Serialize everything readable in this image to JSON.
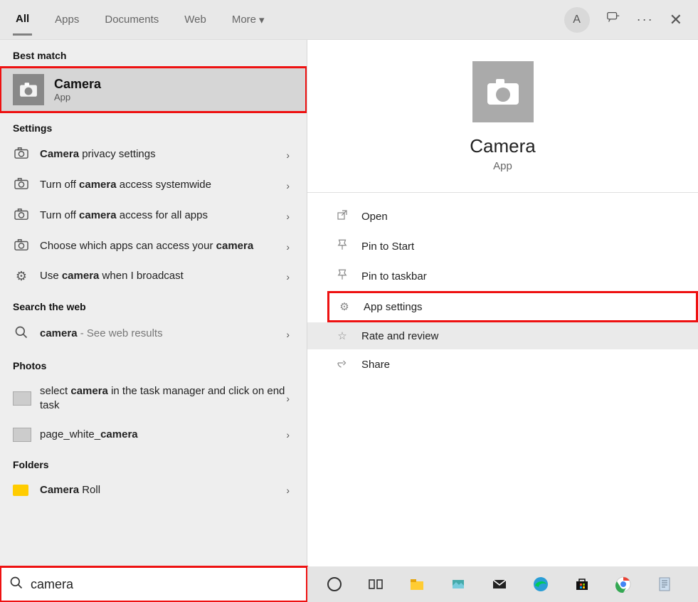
{
  "topbar": {
    "tabs": [
      "All",
      "Apps",
      "Documents",
      "Web",
      "More"
    ],
    "avatar_letter": "A"
  },
  "left": {
    "best_match_label": "Best match",
    "best_match": {
      "title": "Camera",
      "subtitle": "App"
    },
    "settings_label": "Settings",
    "settings": [
      {
        "pre": "",
        "bold": "Camera",
        "post": " privacy settings"
      },
      {
        "pre": "Turn off ",
        "bold": "camera",
        "post": " access systemwide"
      },
      {
        "pre": "Turn off ",
        "bold": "camera",
        "post": " access for all apps"
      },
      {
        "pre": "Choose which apps can access your ",
        "bold": "camera",
        "post": ""
      },
      {
        "pre": "Use ",
        "bold": "camera",
        "post": " when I broadcast",
        "gear": true
      }
    ],
    "web_label": "Search the web",
    "web": {
      "bold": "camera",
      "post": " - See web results"
    },
    "photos_label": "Photos",
    "photos": [
      {
        "pre": "select ",
        "bold": "camera",
        "post": " in the task manager and click on end task"
      },
      {
        "pre": "page_white_",
        "bold": "camera",
        "post": ""
      }
    ],
    "folders_label": "Folders",
    "folders": [
      {
        "bold": "Camera",
        "post": " Roll"
      }
    ]
  },
  "right": {
    "title": "Camera",
    "subtitle": "App",
    "actions": [
      {
        "label": "Open",
        "icon": "open"
      },
      {
        "label": "Pin to Start",
        "icon": "pin"
      },
      {
        "label": "Pin to taskbar",
        "icon": "pin"
      },
      {
        "label": "App settings",
        "icon": "gear",
        "highlight": true
      },
      {
        "label": "Rate and review",
        "icon": "star",
        "hover": true
      },
      {
        "label": "Share",
        "icon": "share"
      }
    ]
  },
  "search": {
    "value": "camera"
  }
}
